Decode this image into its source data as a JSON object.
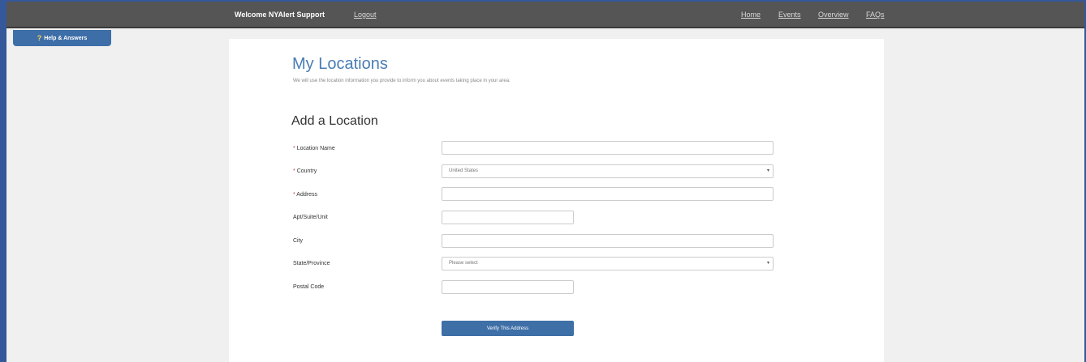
{
  "header": {
    "welcome": "Welcome NYAlert Support",
    "logout": "Logout",
    "nav": [
      "Home",
      "Events",
      "Overview",
      "FAQs"
    ]
  },
  "help_tab": {
    "icon": "question-icon",
    "label": "Help & Answers"
  },
  "page": {
    "title": "My Locations",
    "intro": "We will use the location information you provide to inform you about events taking place in your area."
  },
  "form": {
    "section_title": "Add a Location",
    "fields": {
      "location_name": {
        "label": "Location Name",
        "required": true,
        "value": ""
      },
      "country": {
        "label": "Country",
        "required": true,
        "value": "United States"
      },
      "address": {
        "label": "Address",
        "required": true,
        "value": ""
      },
      "apt": {
        "label": "Apt/Suite/Unit",
        "value": ""
      },
      "city": {
        "label": "City",
        "value": ""
      },
      "state": {
        "label": "State/Province",
        "value": "Please select"
      },
      "postal": {
        "label": "Postal Code",
        "value": ""
      }
    },
    "required_marker": "*",
    "verify_button": "Verify This Address"
  },
  "colors": {
    "topbar": "#555555",
    "accent": "#3e6fa7",
    "title": "#4a7db3",
    "frame": "#34589a"
  }
}
